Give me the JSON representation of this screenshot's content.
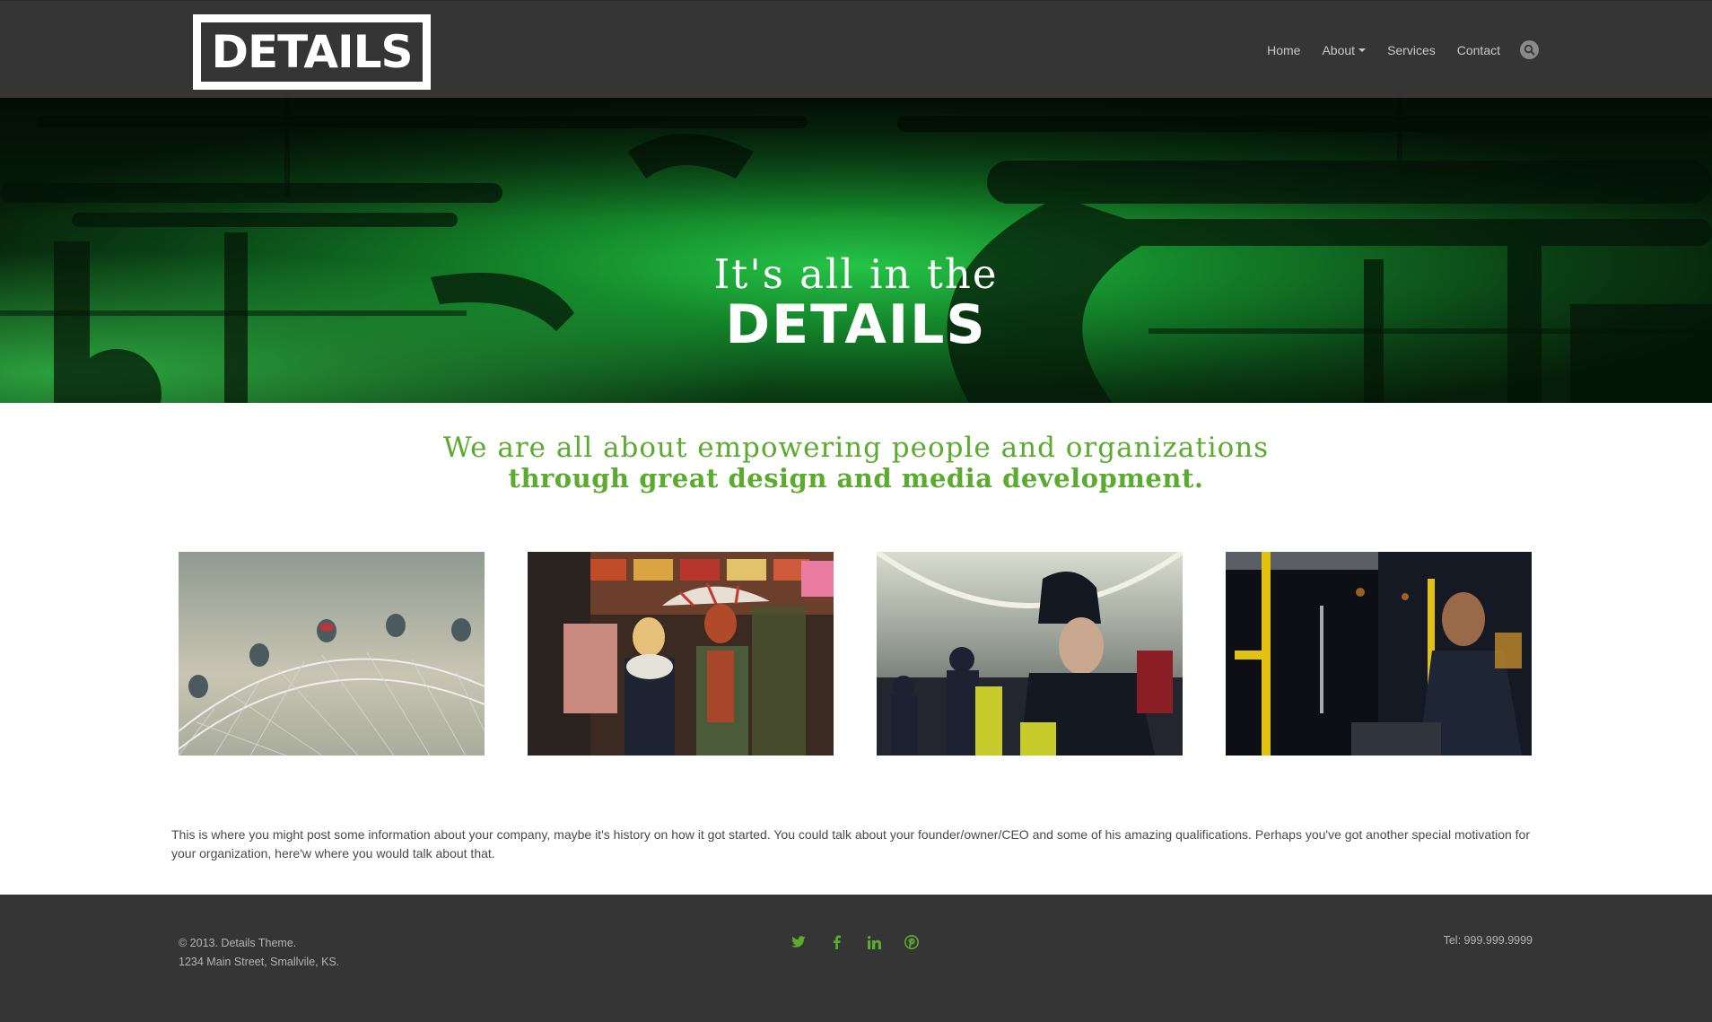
{
  "header": {
    "logo_text": "DETAILS",
    "nav": [
      {
        "label": "Home"
      },
      {
        "label": "About"
      },
      {
        "label": "Services"
      },
      {
        "label": "Contact"
      }
    ],
    "search_icon": "search-icon"
  },
  "hero": {
    "line1": "It's all in the",
    "line2": "DETAILS"
  },
  "tagline": {
    "line1": "We are all about empowering people and organizations",
    "line2": "through great design and media development."
  },
  "photos": [
    {
      "name": "ferris-wheel-photo"
    },
    {
      "name": "market-umbrella-photo"
    },
    {
      "name": "police-officer-photo"
    },
    {
      "name": "train-passenger-photo"
    }
  ],
  "about": {
    "text": "This is where you might post some information about your company, maybe it's history on how it got started. You could talk about your founder/owner/CEO and some of his amazing qualifications. Perhaps you've got another special motivation for your organization, here'w where you would talk about that."
  },
  "footer": {
    "copyright": "© 2013. Details Theme.",
    "address": "1234 Main Street, Smallvile, KS.",
    "phone": "Tel: 999.999.9999",
    "social": [
      "twitter-icon",
      "facebook-icon",
      "linkedin-icon",
      "pinterest-icon"
    ]
  },
  "colors": {
    "header_bg": "#353535",
    "accent_green": "#5aab2e",
    "hero_green": "#1fae3a",
    "text_gray": "#4a4a4a",
    "footer_text": "#b5b5b5"
  }
}
